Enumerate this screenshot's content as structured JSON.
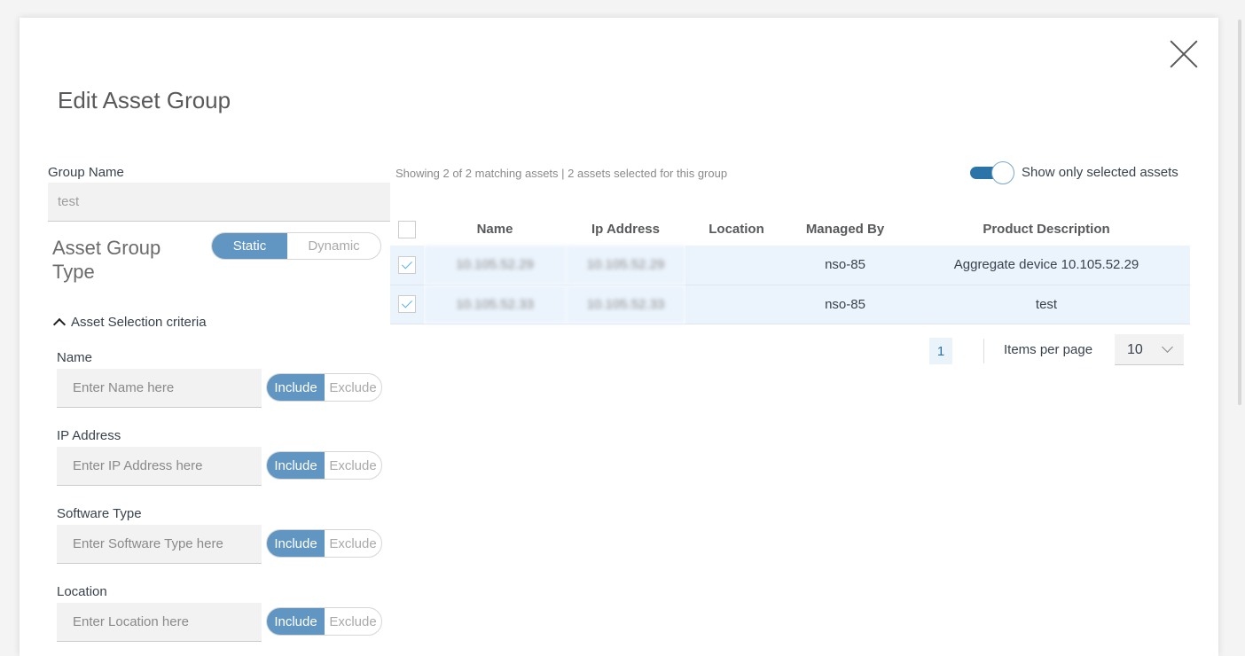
{
  "title": "Edit Asset Group",
  "group_name": {
    "label": "Group Name",
    "value": "test"
  },
  "group_type": {
    "label": "Asset Group Type",
    "options": [
      "Static",
      "Dynamic"
    ],
    "selected": "Static"
  },
  "criteria": {
    "title": "Asset Selection criteria",
    "fields": [
      {
        "label": "Name",
        "placeholder": "Enter Name here"
      },
      {
        "label": "IP Address",
        "placeholder": "Enter IP Address here"
      },
      {
        "label": "Software Type",
        "placeholder": "Enter Software Type here"
      },
      {
        "label": "Location",
        "placeholder": "Enter Location here"
      }
    ],
    "include": "Include",
    "exclude": "Exclude"
  },
  "info": "Showing 2 of 2 matching assets | 2 assets selected for this group",
  "toggle_label": "Show only selected assets",
  "table": {
    "headers": [
      "Name",
      "Ip Address",
      "Location",
      "Managed By",
      "Product Description"
    ],
    "rows": [
      {
        "name": "10.105.52.29",
        "ip": "10.105.52.29",
        "location": "",
        "managed_by": "nso-85",
        "description": "Aggregate device 10.105.52.29"
      },
      {
        "name": "10.105.52.33",
        "ip": "10.105.52.33",
        "location": "",
        "managed_by": "nso-85",
        "description": "test"
      }
    ]
  },
  "pagination": {
    "page": "1",
    "items_label": "Items per page",
    "per_page": "10"
  }
}
